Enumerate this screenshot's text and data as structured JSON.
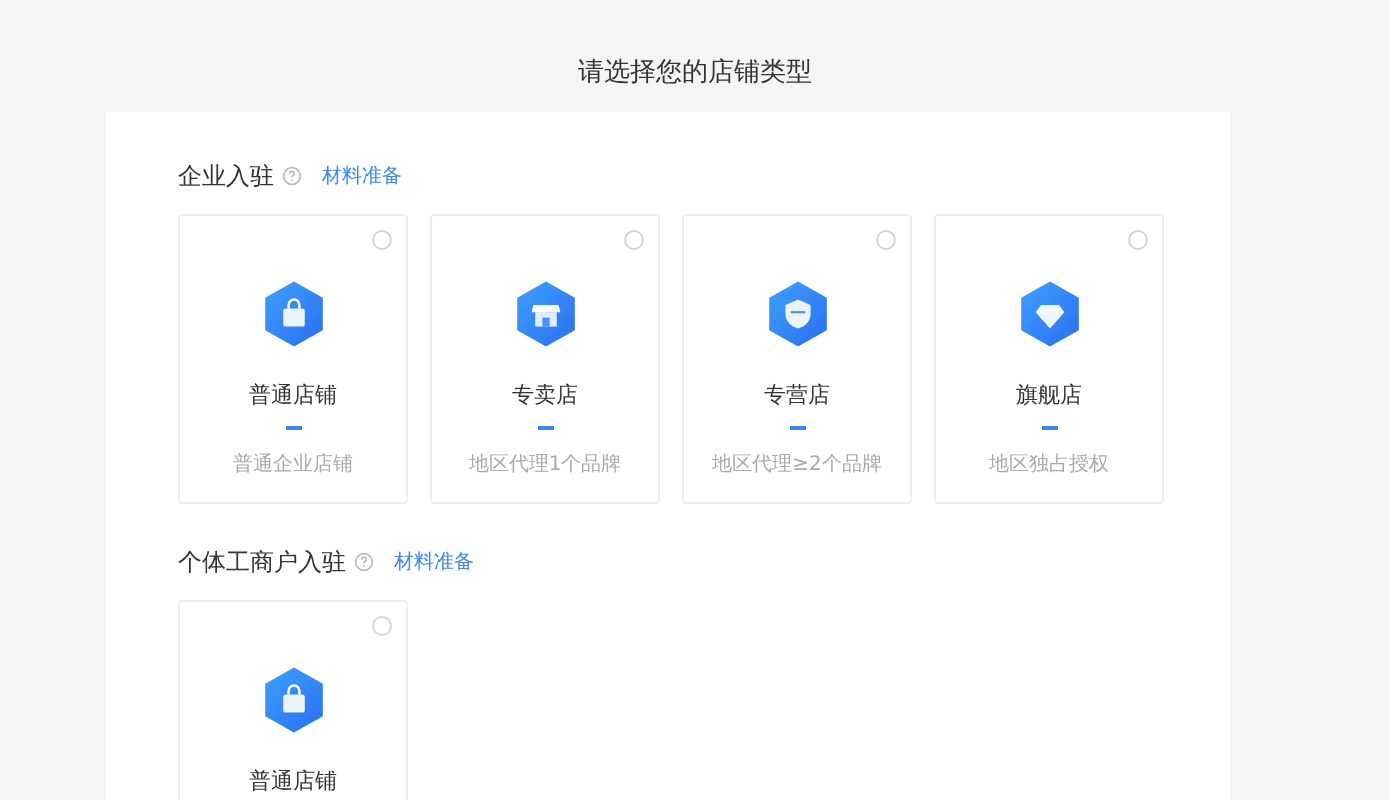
{
  "page_title": "请选择您的店铺类型",
  "sections": [
    {
      "title": "企业入驻",
      "link": "材料准备",
      "cards": [
        {
          "kind": "bag",
          "name": "普通店铺",
          "description": "普通企业店铺",
          "selected": false
        },
        {
          "kind": "store",
          "name": "专卖店",
          "description": "地区代理1个品牌",
          "selected": false
        },
        {
          "kind": "shield",
          "name": "专营店",
          "description": "地区代理≥2个品牌",
          "selected": false
        },
        {
          "kind": "diamond",
          "name": "旗舰店",
          "description": "地区独占授权",
          "selected": false
        }
      ]
    },
    {
      "title": "个体工商户入驻",
      "link": "材料准备",
      "cards": [
        {
          "kind": "bag",
          "name": "普通店铺",
          "selected": false
        }
      ]
    }
  ]
}
